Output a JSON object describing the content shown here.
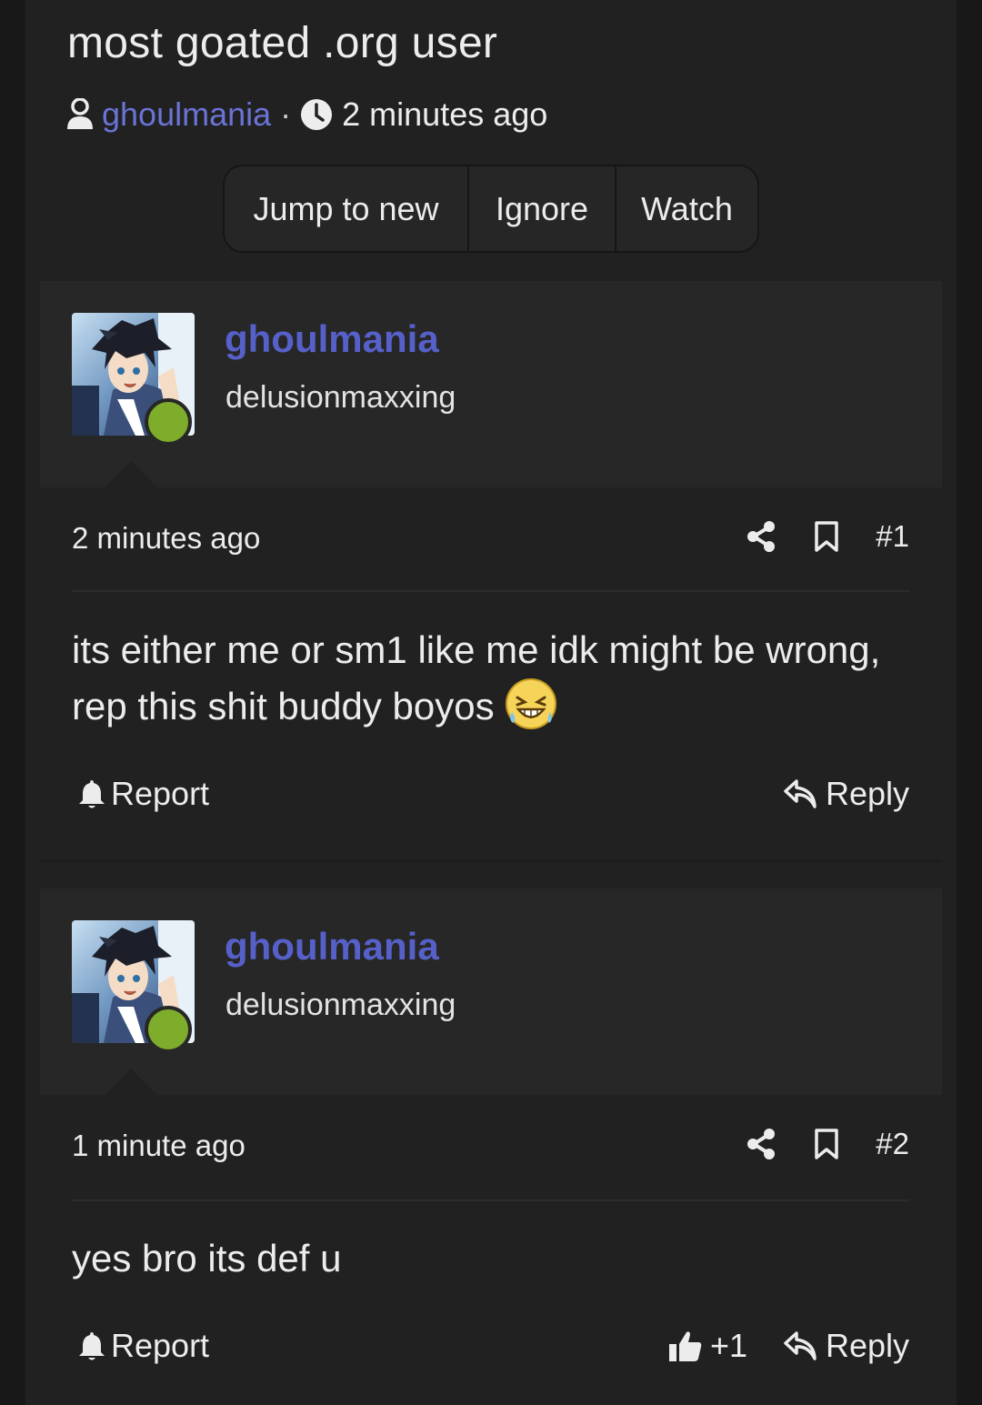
{
  "thread": {
    "title": "most goated .org user",
    "author": "ghoulmania",
    "separator": "·",
    "time": "2 minutes ago"
  },
  "actions": {
    "jump_label": "Jump to new",
    "ignore_label": "Ignore",
    "watch_label": "Watch"
  },
  "posts": [
    {
      "username": "ghoulmania",
      "user_title": "delusionmaxxing",
      "time": "2 minutes ago",
      "number": "#1",
      "body": "its either me or sm1 like me idk might be wrong, rep this shit buddy boyos",
      "emoji": "laughing-with-tears",
      "report_label": "Report",
      "reply_label": "Reply"
    },
    {
      "username": "ghoulmania",
      "user_title": "delusionmaxxing",
      "time": "1 minute ago",
      "number": "#2",
      "body": "yes bro its def u",
      "report_label": "Report",
      "like_count": "+1",
      "reply_label": "Reply"
    }
  ],
  "colors": {
    "background": "#212121",
    "author_link": "#6a74d6",
    "username": "#5660c9",
    "online": "#7dad2b"
  }
}
